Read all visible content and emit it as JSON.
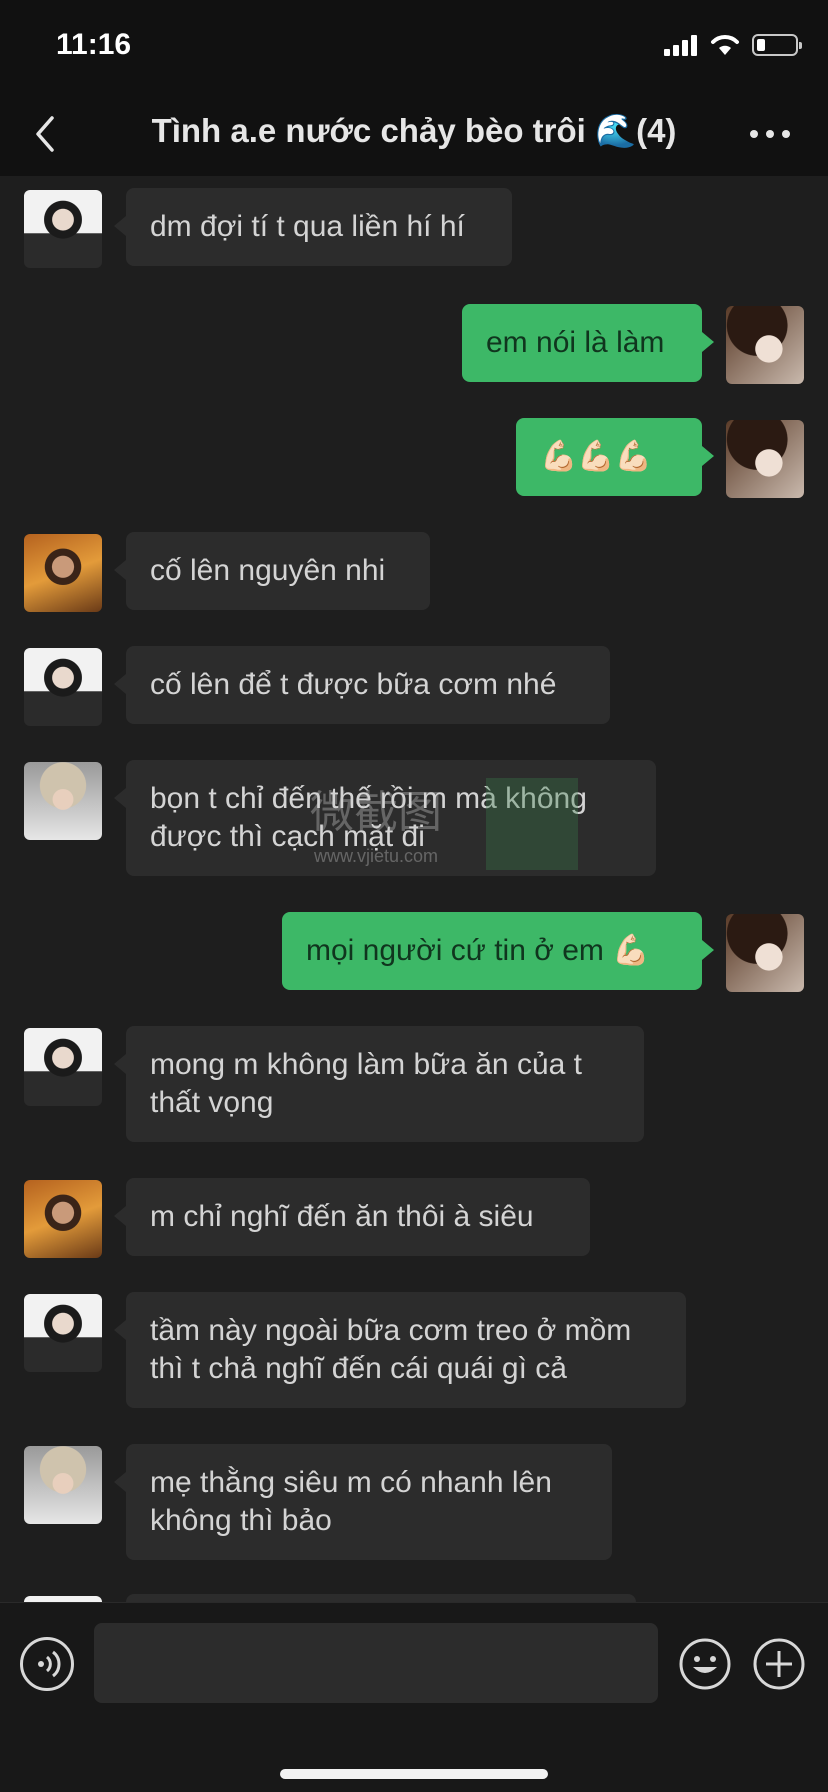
{
  "status_bar": {
    "time": "11:16",
    "icons": [
      "signal-icon",
      "wifi-icon",
      "battery-icon"
    ]
  },
  "header": {
    "title": "Tình a.e nước chảy bèo trôi 🌊(4)",
    "back_icon": "chevron-left-icon",
    "more_icon": "more-dots-icon"
  },
  "messages": [
    {
      "side": "left",
      "avatar": "avatar-boy",
      "text": "dm đợi tí t qua liền hí hí"
    },
    {
      "side": "right",
      "avatar": "avatar-me",
      "text": "em nói là làm"
    },
    {
      "side": "right",
      "avatar": "avatar-me",
      "text": "💪🏻💪🏻💪🏻"
    },
    {
      "side": "left",
      "avatar": "avatar-orange",
      "text": "cố lên nguyên nhi"
    },
    {
      "side": "left",
      "avatar": "avatar-boy",
      "text": "cố lên để t được bữa cơm nhé"
    },
    {
      "side": "left",
      "avatar": "avatar-blond",
      "text": "bọn t chỉ đến thế rồi m mà không được thì cạch mặt đi"
    },
    {
      "side": "right",
      "avatar": "avatar-me",
      "text": "mọi người cứ tin ở em 💪🏻"
    },
    {
      "side": "left",
      "avatar": "avatar-boy",
      "text": "mong m không làm bữa ăn của t thất vọng"
    },
    {
      "side": "left",
      "avatar": "avatar-orange",
      "text": "m chỉ nghĩ đến ăn thôi à siêu"
    },
    {
      "side": "left",
      "avatar": "avatar-boy",
      "text": "tầm này ngoài bữa cơm treo ở mồm thì t chả nghĩ đến cái quái gì cả"
    },
    {
      "side": "left",
      "avatar": "avatar-blond",
      "text": "mẹ thằng siêu m có nhanh lên không thì bảo"
    }
  ],
  "watermark": {
    "text": "微截图",
    "url": "www.vjietu.com"
  },
  "input_bar": {
    "voice_icon": "voice-icon",
    "input_value": "",
    "emoji_icon": "emoji-icon",
    "plus_icon": "plus-icon"
  },
  "colors": {
    "background": "#1e1e1e",
    "incoming_bubble": "#2c2c2c",
    "outgoing_bubble": "#3db867"
  }
}
